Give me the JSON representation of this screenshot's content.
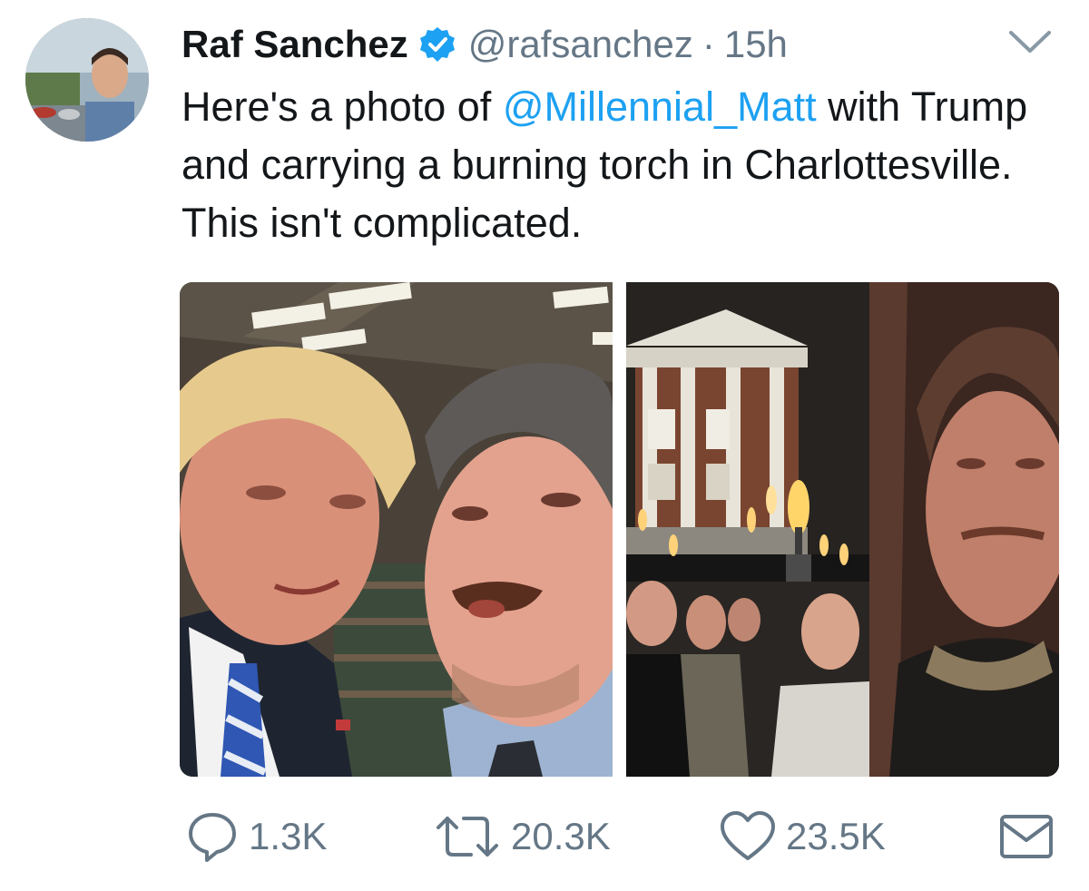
{
  "tweet": {
    "author_name": "Raf Sanchez",
    "handle": "@rafsanchez",
    "separator": "·",
    "time": "15h",
    "text_before": "Here's a photo of ",
    "mention": "@Millennial_Matt",
    "text_after": " with Trump and carrying a burning torch in Charlottesville. This isn't complicated.",
    "verified_color": "#1da1f2",
    "link_color": "#1da1f2"
  },
  "actions": {
    "replies": "1.3K",
    "retweets": "20.3K",
    "likes": "23.5K"
  },
  "icons": {
    "reply": "reply-icon",
    "retweet": "retweet-icon",
    "like": "heart-icon",
    "dm": "envelope-icon",
    "menu": "chevron-down-icon",
    "verified": "verified-badge-icon"
  }
}
